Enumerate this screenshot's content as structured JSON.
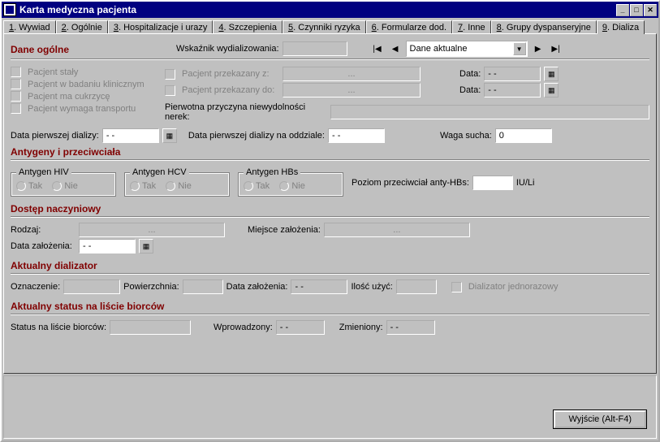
{
  "window": {
    "title": "Karta medyczna pacjenta"
  },
  "tabs": [
    {
      "n": "1",
      "label": "Wywiad"
    },
    {
      "n": "2",
      "label": "Ogólnie"
    },
    {
      "n": "3",
      "label": "Hospitalizacje i urazy"
    },
    {
      "n": "4",
      "label": "Szczepienia"
    },
    {
      "n": "5",
      "label": "Czynniki ryzyka"
    },
    {
      "n": "6",
      "label": "Formularze dod."
    },
    {
      "n": "7",
      "label": "Inne"
    },
    {
      "n": "8",
      "label": "Grupy dyspanseryjne"
    },
    {
      "n": "9",
      "label": "Dializa"
    }
  ],
  "header": {
    "wskaznik_label": "Wskaźnik wydializowania:",
    "wskaznik_value": "",
    "dropdown_value": "Dane aktualne"
  },
  "dane_ogolne": {
    "title": "Dane ogólne",
    "chk_staly": "Pacjent stały",
    "chk_badanie": "Pacjent w badaniu klinicznym",
    "chk_cukrzyca": "Pacjent ma cukrzycę",
    "chk_transport": "Pacjent wymaga transportu",
    "przekazany_z": "Pacjent przekazany z:",
    "przekazany_do": "Pacjent przekazany do:",
    "ellipsis": "...",
    "data_label": "Data:",
    "data_value": "- -",
    "przyczyna_label": "Pierwotna przyczyna niewydolności nerek:",
    "przyczyna_value": "",
    "data_pierwszej_label": "Data pierwszej dializy:",
    "data_pierwszej_value": "- -",
    "data_oddzial_label": "Data pierwszej dializy na oddziale:",
    "data_oddzial_value": "- -",
    "waga_label": "Waga sucha:",
    "waga_value": "0"
  },
  "antygeny": {
    "title": "Antygeny i przeciwciała",
    "hiv": "Antygen HIV",
    "hcv": "Antygen HCV",
    "hbs": "Antygen HBs",
    "tak": "Tak",
    "nie": "Nie",
    "poziom_label": "Poziom przeciwciał anty-HBs:",
    "poziom_value": "",
    "poziom_unit": "IU/Li"
  },
  "dostep": {
    "title": "Dostęp naczyniowy",
    "rodzaj_label": "Rodzaj:",
    "miejsce_label": "Miejsce założenia:",
    "ellipsis": "...",
    "data_zal_label": "Data założenia:",
    "data_zal_value": "- -"
  },
  "dializator": {
    "title": "Aktualny dializator",
    "oznaczenie_label": "Oznaczenie:",
    "powierzchnia_label": "Powierzchnia:",
    "data_zal_label": "Data założenia:",
    "data_zal_value": "- -",
    "ilosc_label": "Ilość użyć:",
    "jednorazowy": "Dializator jednorazowy"
  },
  "status": {
    "title": "Aktualny status na liście biorców",
    "status_label": "Status na liście biorców:",
    "wprowadzony_label": "Wprowadzony:",
    "wprowadzony_value": "- -",
    "zmieniony_label": "Zmieniony:",
    "zmieniony_value": "- -"
  },
  "footer": {
    "exit": "Wyjście (Alt-F4)"
  }
}
